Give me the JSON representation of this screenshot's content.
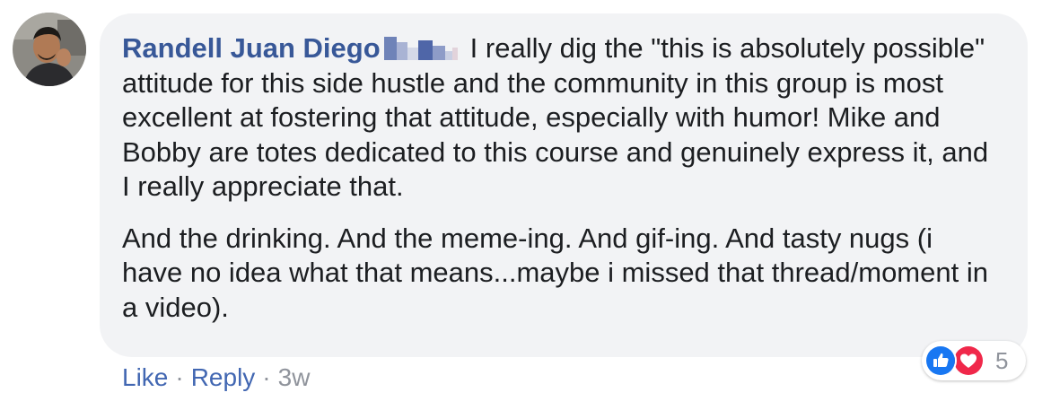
{
  "comment": {
    "author": "Randell Juan Diego",
    "paragraphs": [
      "I really dig the \"this is absolutely possible\" attitude for this side hustle and the community in this group is most excellent at fostering that attitude, especially with humor! Mike and Bobby are totes dedicated to this course and genuinely express it, and I really appreciate that.",
      "And the drinking. And the meme-ing. And gif-ing. And tasty nugs (i have no idea what that means...maybe i missed that thread/moment in a video)."
    ],
    "actions": {
      "like": "Like",
      "separator": "·",
      "reply": "Reply",
      "age": "3w"
    },
    "reactions": {
      "icons": [
        "like-icon",
        "love-icon"
      ],
      "count": "5"
    }
  },
  "colors": {
    "author": "#385898",
    "link": "#4267b2",
    "meta": "#90949c",
    "bubble": "#f2f3f5",
    "like_blue": "#1877f2",
    "love_red": "#f0284a"
  }
}
